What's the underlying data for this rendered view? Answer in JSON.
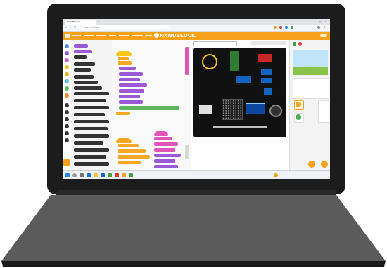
{
  "window": {
    "tab_title": "NKNUBLOCK",
    "url": "127.0.0.1:8601"
  },
  "app": {
    "logo_text": "NKNUBLOCK",
    "menu": [
      "",
      "",
      "",
      "",
      "",
      "",
      "",
      ""
    ]
  },
  "stage": {
    "header": "",
    "board_caption": ""
  },
  "taskbar": {
    "clock": ""
  },
  "colors": {
    "menu_orange": "#f6a11a",
    "laptop_bezel": "#1c1c1c",
    "laptop_base": "#5b5b5b",
    "block_orange": "#f5a623",
    "block_purple": "#9b59d6",
    "block_green": "#5cb85c",
    "block_blue": "#4a90d9",
    "block_pink": "#e056b8"
  }
}
